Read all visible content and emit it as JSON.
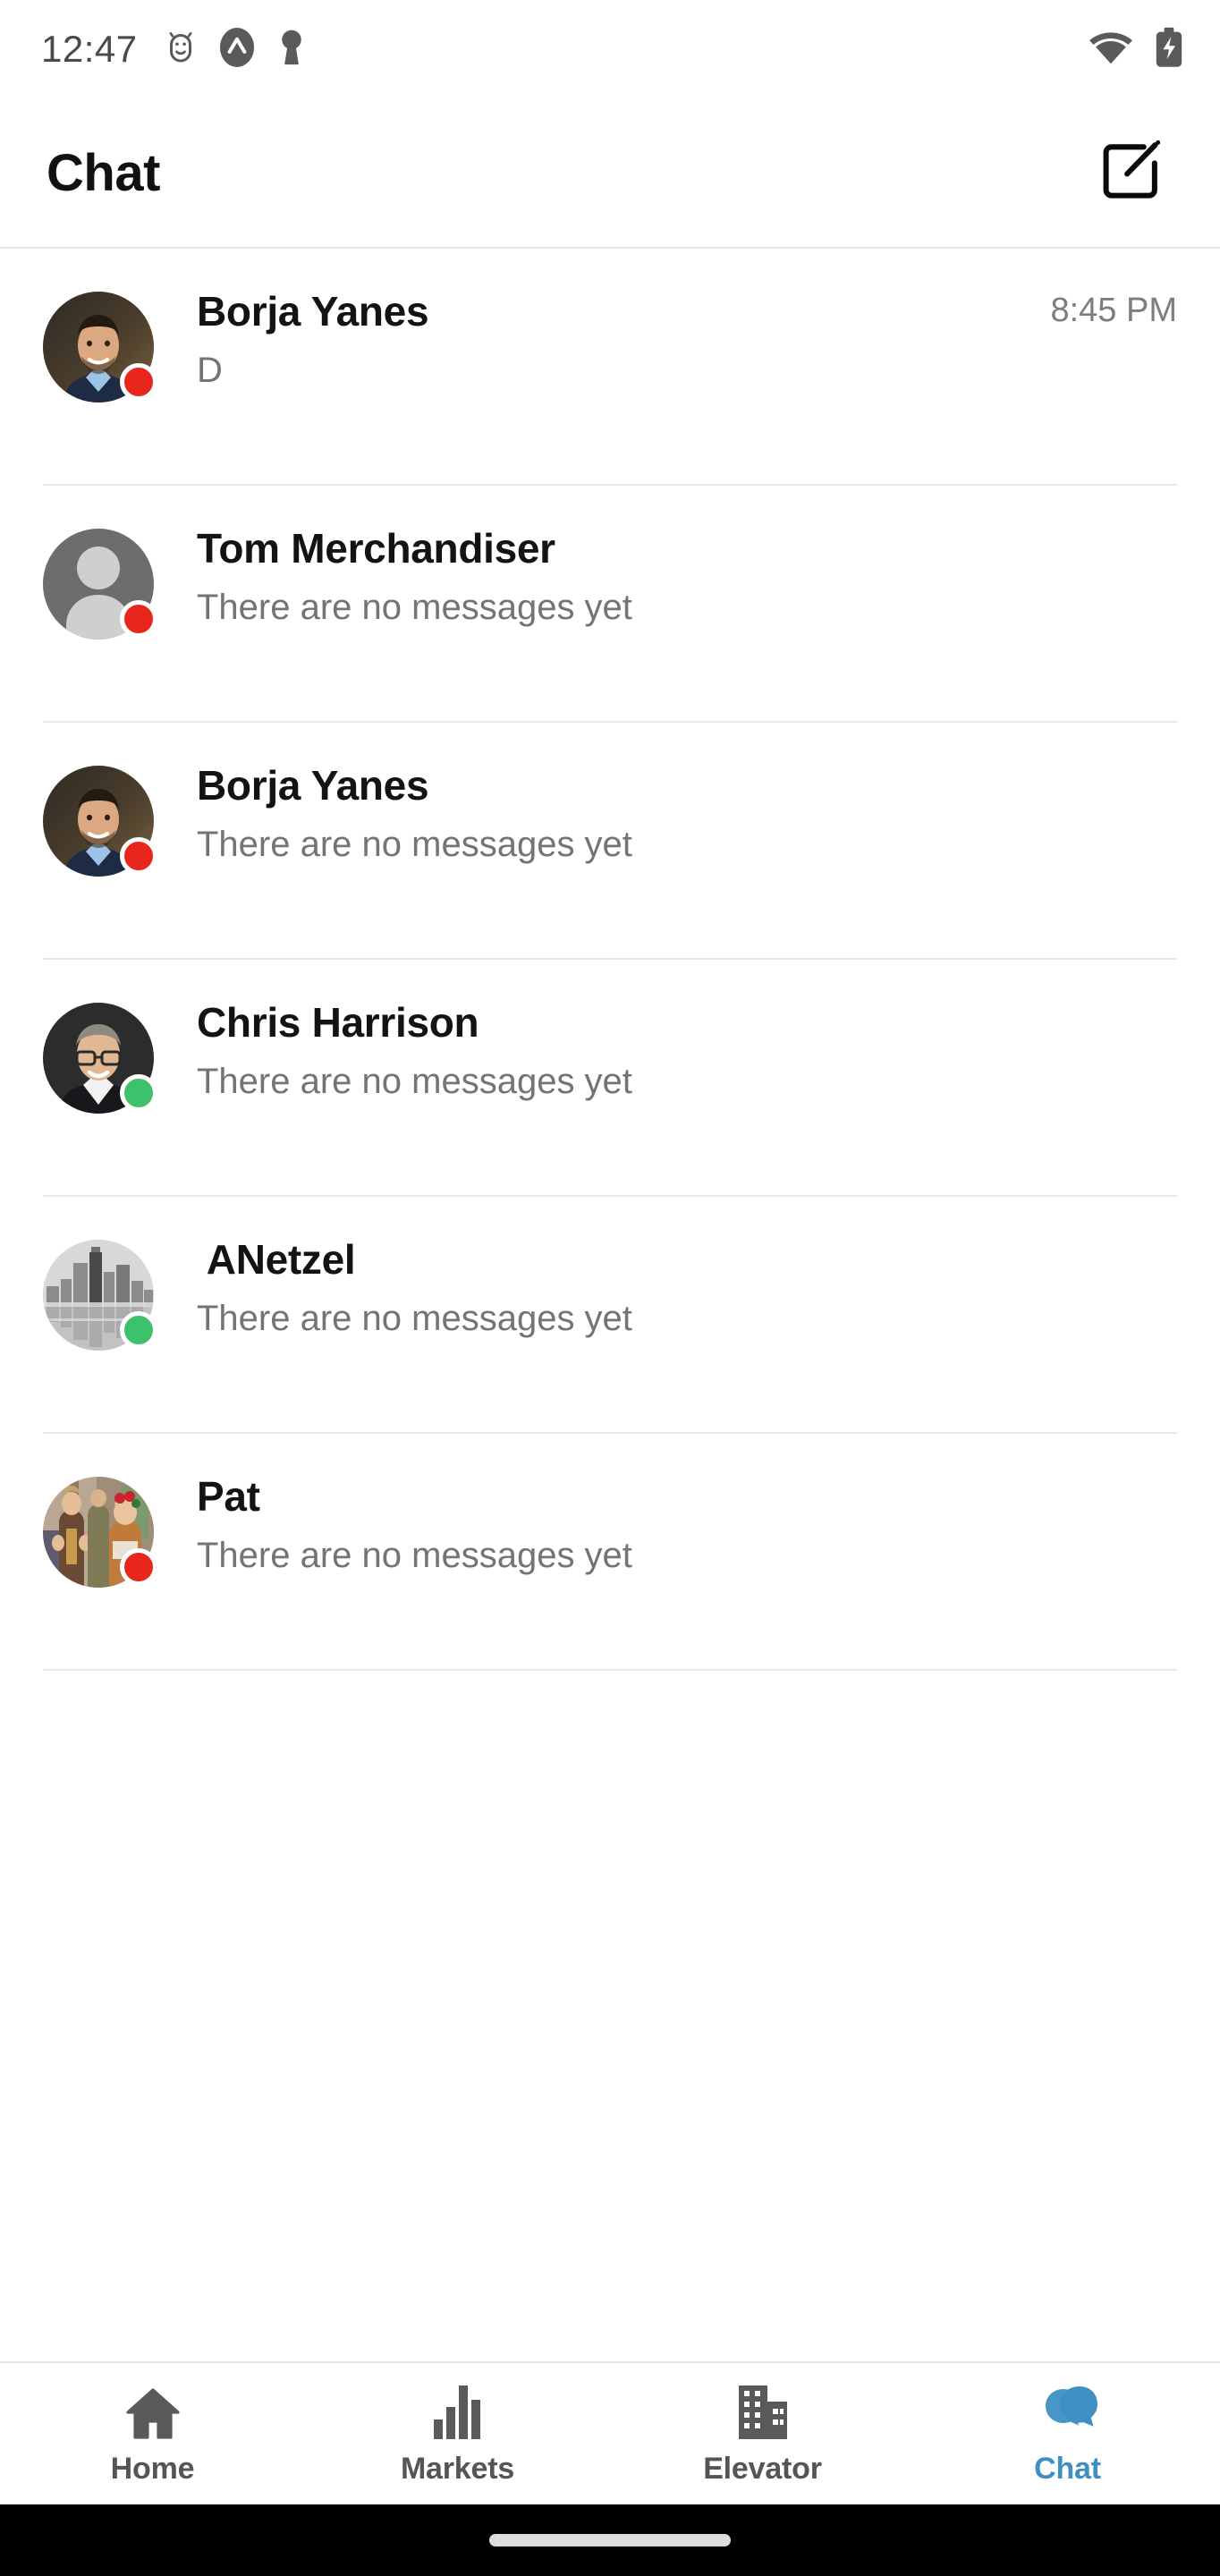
{
  "status_bar": {
    "time": "12:47",
    "left_icons": [
      "alarm-android-icon",
      "app-circle-icon",
      "keyhole-icon"
    ],
    "right_icons": [
      "wifi-icon",
      "battery-charging-icon"
    ]
  },
  "header": {
    "title": "Chat",
    "compose_icon": "compose-icon"
  },
  "chats": [
    {
      "name": "Borja Yanes",
      "preview": "D",
      "time": "8:45 PM",
      "status": "red",
      "status_color": "#e8271c",
      "avatar": "photo-man-beard-blue-shirt"
    },
    {
      "name": "Tom Merchandiser",
      "preview": "There are no messages yet",
      "time": "",
      "status": "red",
      "status_color": "#e8271c",
      "avatar": "default-person-placeholder"
    },
    {
      "name": "Borja Yanes",
      "preview": "There are no messages yet",
      "time": "",
      "status": "red",
      "status_color": "#e8271c",
      "avatar": "photo-man-beard-blue-shirt"
    },
    {
      "name": "Chris Harrison",
      "preview": "There are no messages yet",
      "time": "",
      "status": "green",
      "status_color": "#3ec16b",
      "avatar": "photo-man-glasses-suit"
    },
    {
      "name": " ANetzel",
      "preview": "There are no messages yet",
      "time": "",
      "status": "green",
      "status_color": "#3ec16b",
      "avatar": "photo-city-skyline-grayscale"
    },
    {
      "name": "Pat",
      "preview": "There are no messages yet",
      "time": "",
      "status": "red",
      "status_color": "#e8271c",
      "avatar": "photo-group-people-street"
    }
  ],
  "bottom_nav": {
    "active": "Chat",
    "active_color": "#3e8fc4",
    "inactive_color": "#555555",
    "items": [
      {
        "label": "Home",
        "icon": "home-icon"
      },
      {
        "label": "Markets",
        "icon": "bar-chart-icon"
      },
      {
        "label": "Elevator",
        "icon": "buildings-icon"
      },
      {
        "label": "Chat",
        "icon": "chat-bubbles-icon"
      }
    ]
  }
}
